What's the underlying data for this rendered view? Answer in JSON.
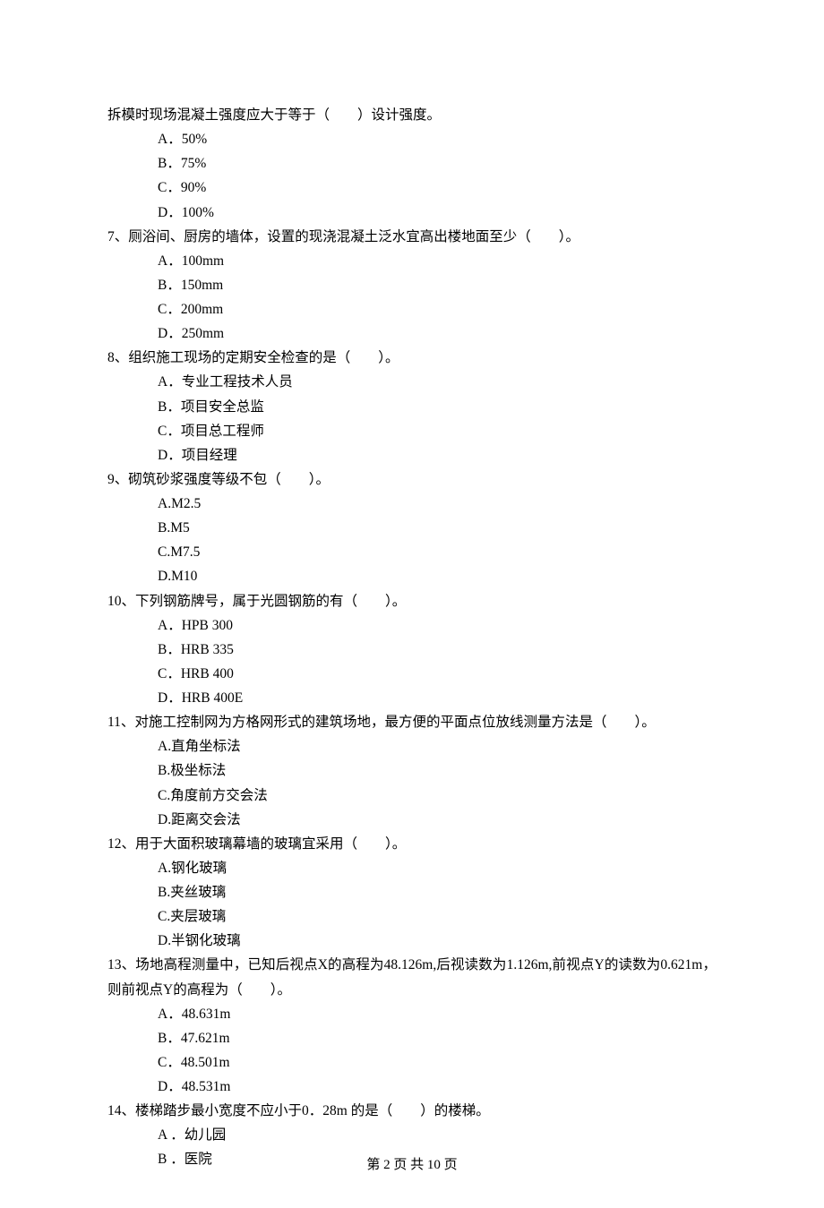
{
  "partial_stem": "拆模时现场混凝土强度应大于等于（　　）设计强度。",
  "partial_options": [
    "A．50%",
    "B．75%",
    "C．90%",
    "D．100%"
  ],
  "questions": [
    {
      "num": "7、",
      "stem": "厕浴间、厨房的墙体，设置的现浇混凝土泛水宜高出楼地面至少（　　）。",
      "options": [
        "A．100mm",
        "B．150mm",
        "C．200mm",
        "D．250mm"
      ]
    },
    {
      "num": "8、",
      "stem": "组织施工现场的定期安全检查的是（　　）。",
      "options": [
        "A．专业工程技术人员",
        "B．项目安全总监",
        "C．项目总工程师",
        "D．项目经理"
      ]
    },
    {
      "num": "9、",
      "stem": "砌筑砂浆强度等级不包（　　）。",
      "options": [
        "A.M2.5",
        "B.M5",
        "C.M7.5",
        "D.M10"
      ]
    },
    {
      "num": "10、",
      "stem": "下列钢筋牌号，属于光圆钢筋的有（　　）。",
      "options": [
        "A．HPB 300",
        "B．HRB 335",
        "C．HRB 400",
        "D．HRB 400E"
      ]
    },
    {
      "num": "11、",
      "stem": "对施工控制网为方格网形式的建筑场地，最方便的平面点位放线测量方法是（　　）。",
      "options": [
        "A.直角坐标法",
        "B.极坐标法",
        "C.角度前方交会法",
        "D.距离交会法"
      ]
    },
    {
      "num": "12、",
      "stem": "用于大面积玻璃幕墙的玻璃宜采用（　　）。",
      "options": [
        "A.钢化玻璃",
        "B.夹丝玻璃",
        "C.夹层玻璃",
        "D.半钢化玻璃"
      ]
    },
    {
      "num": "13、",
      "stem": "场地高程测量中，已知后视点X的高程为48.126m,后视读数为1.126m,前视点Y的读数为0.621m，则前视点Y的高程为（　　）。",
      "options": [
        "A．48.631m",
        "B．47.621m",
        "C．48.501m",
        "D．48.531m"
      ]
    },
    {
      "num": "14、",
      "stem": "楼梯踏步最小宽度不应小于0．28m 的是（　　）的楼梯。",
      "options": [
        "A ．幼儿园",
        "B ．医院"
      ]
    }
  ],
  "footer": "第 2 页 共 10 页"
}
